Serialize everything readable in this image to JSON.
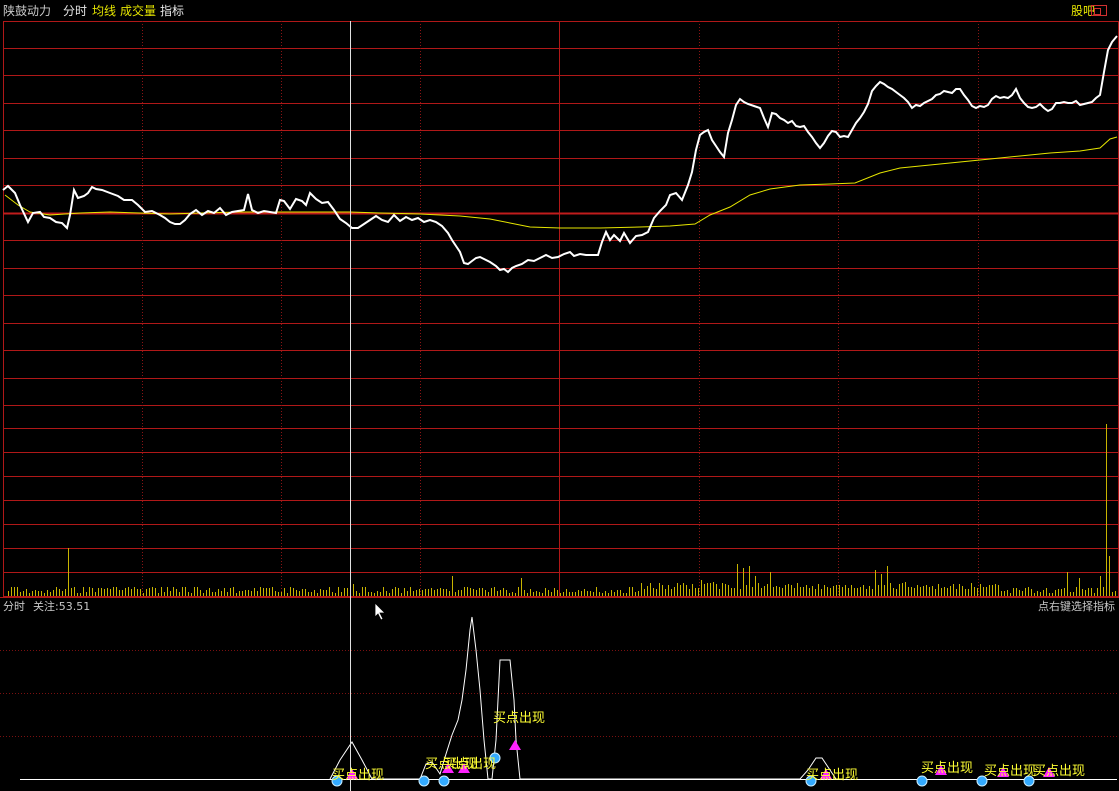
{
  "header": {
    "title": "陕鼓动力",
    "tabs": [
      "分时",
      "均线",
      "成交量",
      "指标"
    ],
    "guba": "股吧"
  },
  "sub_panel": {
    "period_label": "分时",
    "focus_label": "关注:53.51",
    "hint": "点右键选择指标",
    "signal_text": "买点出现"
  },
  "colors": {
    "background": "#000000",
    "grid_red": "#b01818",
    "price_line": "#ffffff",
    "avg_line": "#e6e600",
    "volume_bars": "#c8b400",
    "signal_text": "#ffff33",
    "marker_triangle": "#ff22ff",
    "marker_dot": "#33aaff"
  },
  "icons": [
    "window-restore-icon",
    "mouse-pointer-icon",
    "signal-triangle-icon",
    "signal-dot-icon"
  ]
}
